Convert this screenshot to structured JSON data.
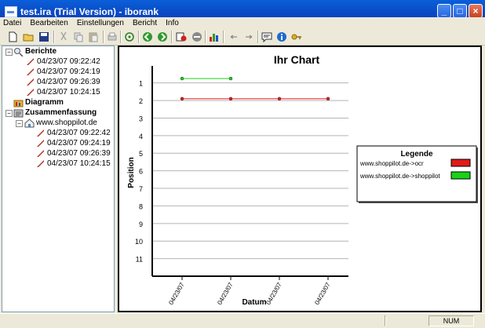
{
  "window": {
    "title": "test.ira (Trial Version) - iborank"
  },
  "menu": {
    "items": [
      "Datei",
      "Bearbeiten",
      "Einstellungen",
      "Bericht",
      "Info"
    ]
  },
  "toolbar": {
    "icons": [
      "new-document-icon",
      "open-folder-icon",
      "save-icon",
      "cut-icon",
      "copy-icon",
      "paste-icon",
      "print-icon",
      "target-icon",
      "go-back-icon",
      "go-forward-icon",
      "report-icon",
      "stop-icon",
      "chart-icon",
      "undo-icon",
      "redo-icon",
      "comment-icon",
      "info-icon",
      "key-icon"
    ]
  },
  "tree": {
    "berichte": {
      "label": "Berichte",
      "reports": [
        "04/23/07 09:22:42",
        "04/23/07 09:24:19",
        "04/23/07 09:26:39",
        "04/23/07 10:24:15"
      ]
    },
    "diagramm": {
      "label": "Diagramm"
    },
    "zusammenfassung": {
      "label": "Zusammenfassung",
      "site": "www.shoppilot.de",
      "reports": [
        "04/23/07 09:22:42",
        "04/23/07 09:24:19",
        "04/23/07 09:26:39",
        "04/23/07 10:24:15"
      ]
    }
  },
  "chart_data": {
    "type": "line",
    "title": "Ihr Chart",
    "xlabel": "Datum",
    "ylabel": "Position",
    "x_ticks": [
      "04/23/07",
      "04/23/07",
      "04/23/07",
      "04/23/07"
    ],
    "y_ticks": [
      1,
      2,
      3,
      4,
      5,
      6,
      7,
      8,
      9,
      10,
      11
    ],
    "ylim": [
      0.3,
      12
    ],
    "y_inverted": true,
    "grid": true,
    "legend_title": "Legende",
    "legend_position": "right",
    "series": [
      {
        "name": "www.shoppilot.de->ocr",
        "color": "#e11919",
        "points": [
          [
            1,
            1.9
          ],
          [
            2,
            1.9
          ],
          [
            3,
            1.9
          ],
          [
            4,
            1.9
          ]
        ]
      },
      {
        "name": "www.shoppilot.de->shoppilot",
        "color": "#19d219",
        "points": [
          [
            1,
            0.75
          ],
          [
            2,
            0.75
          ]
        ]
      }
    ]
  },
  "status": {
    "num": "NUM"
  }
}
